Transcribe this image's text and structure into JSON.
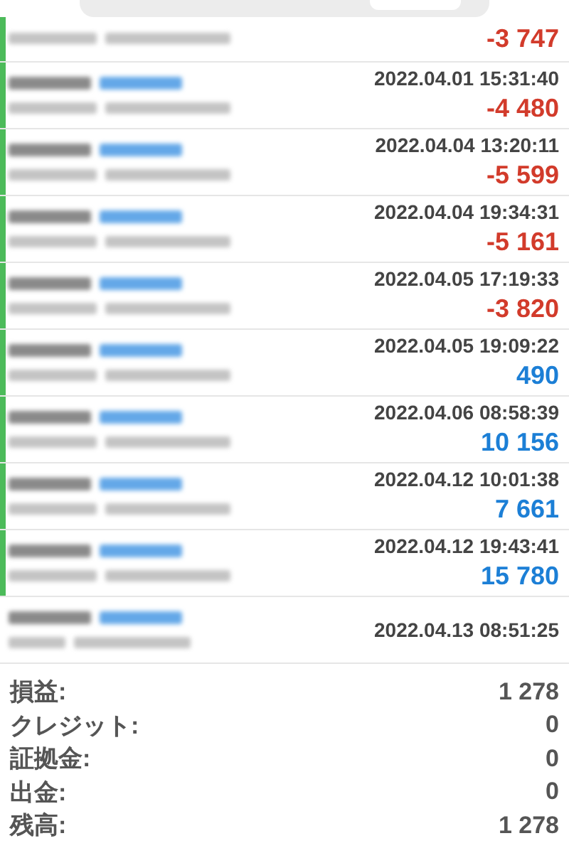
{
  "history": [
    {
      "kind": "deal",
      "profit": "-3 747",
      "color": "#d23b2b"
    },
    {
      "kind": "deal",
      "time": "2022.04.01 15:31:40",
      "profit": "-4 480",
      "color": "#d23b2b"
    },
    {
      "kind": "deal",
      "time": "2022.04.04 13:20:11",
      "profit": "-5 599",
      "color": "#d23b2b"
    },
    {
      "kind": "deal",
      "time": "2022.04.04 19:34:31",
      "profit": "-5 161",
      "color": "#d23b2b"
    },
    {
      "kind": "deal",
      "time": "2022.04.05 17:19:33",
      "profit": "-3 820",
      "color": "#d23b2b"
    },
    {
      "kind": "deal",
      "time": "2022.04.05 19:09:22",
      "profit": "490",
      "color": "#1c7fd6"
    },
    {
      "kind": "deal",
      "time": "2022.04.06 08:58:39",
      "profit": "10 156",
      "color": "#1c7fd6"
    },
    {
      "kind": "deal",
      "time": "2022.04.12 10:01:38",
      "profit": "7 661",
      "color": "#1c7fd6"
    },
    {
      "kind": "deal",
      "time": "2022.04.12 19:43:41",
      "profit": "15 780",
      "color": "#1c7fd6"
    },
    {
      "kind": "order",
      "time": "2022.04.13 08:51:25"
    }
  ],
  "summary": [
    {
      "label": "損益:",
      "value": "1 278"
    },
    {
      "label": "クレジット:",
      "value": "0"
    },
    {
      "label": "証拠金:",
      "value": "0"
    },
    {
      "label": "出金:",
      "value": "0"
    },
    {
      "label": "残高:",
      "value": "1 278"
    }
  ]
}
